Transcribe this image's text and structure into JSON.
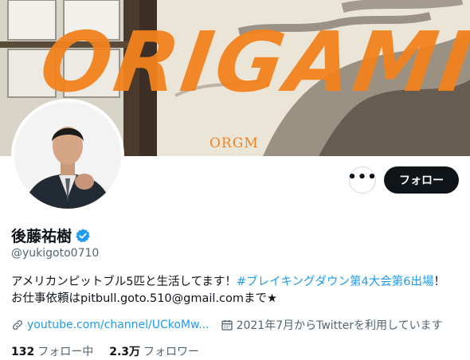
{
  "banner": {
    "title": "ORIGAMI",
    "subtitle": "ORGM"
  },
  "profile": {
    "display_name": "後藤祐樹",
    "handle": "@yukigoto0710",
    "verified": true,
    "bio_part1": "アメリカンピットブル5匹と生活してます！",
    "bio_hashtag": "#ブレイキングダウン第4大会第6出場",
    "bio_part2": "！",
    "bio_line2": "お仕事依頼はpitbull.goto.510@gmail.comまで★",
    "website": "youtube.com/channel/UCkoMw...",
    "joined": "2021年7月からTwitterを利用しています",
    "following_count": "132",
    "following_label": "フォロー中",
    "followers_count": "2.3万",
    "followers_label": "フォロワー"
  },
  "actions": {
    "more_label": "•••",
    "follow_label": "フォロー"
  },
  "colors": {
    "accent": "#1d9bf0",
    "banner_text": "#f2821e",
    "follow_button": "#0f1419"
  }
}
